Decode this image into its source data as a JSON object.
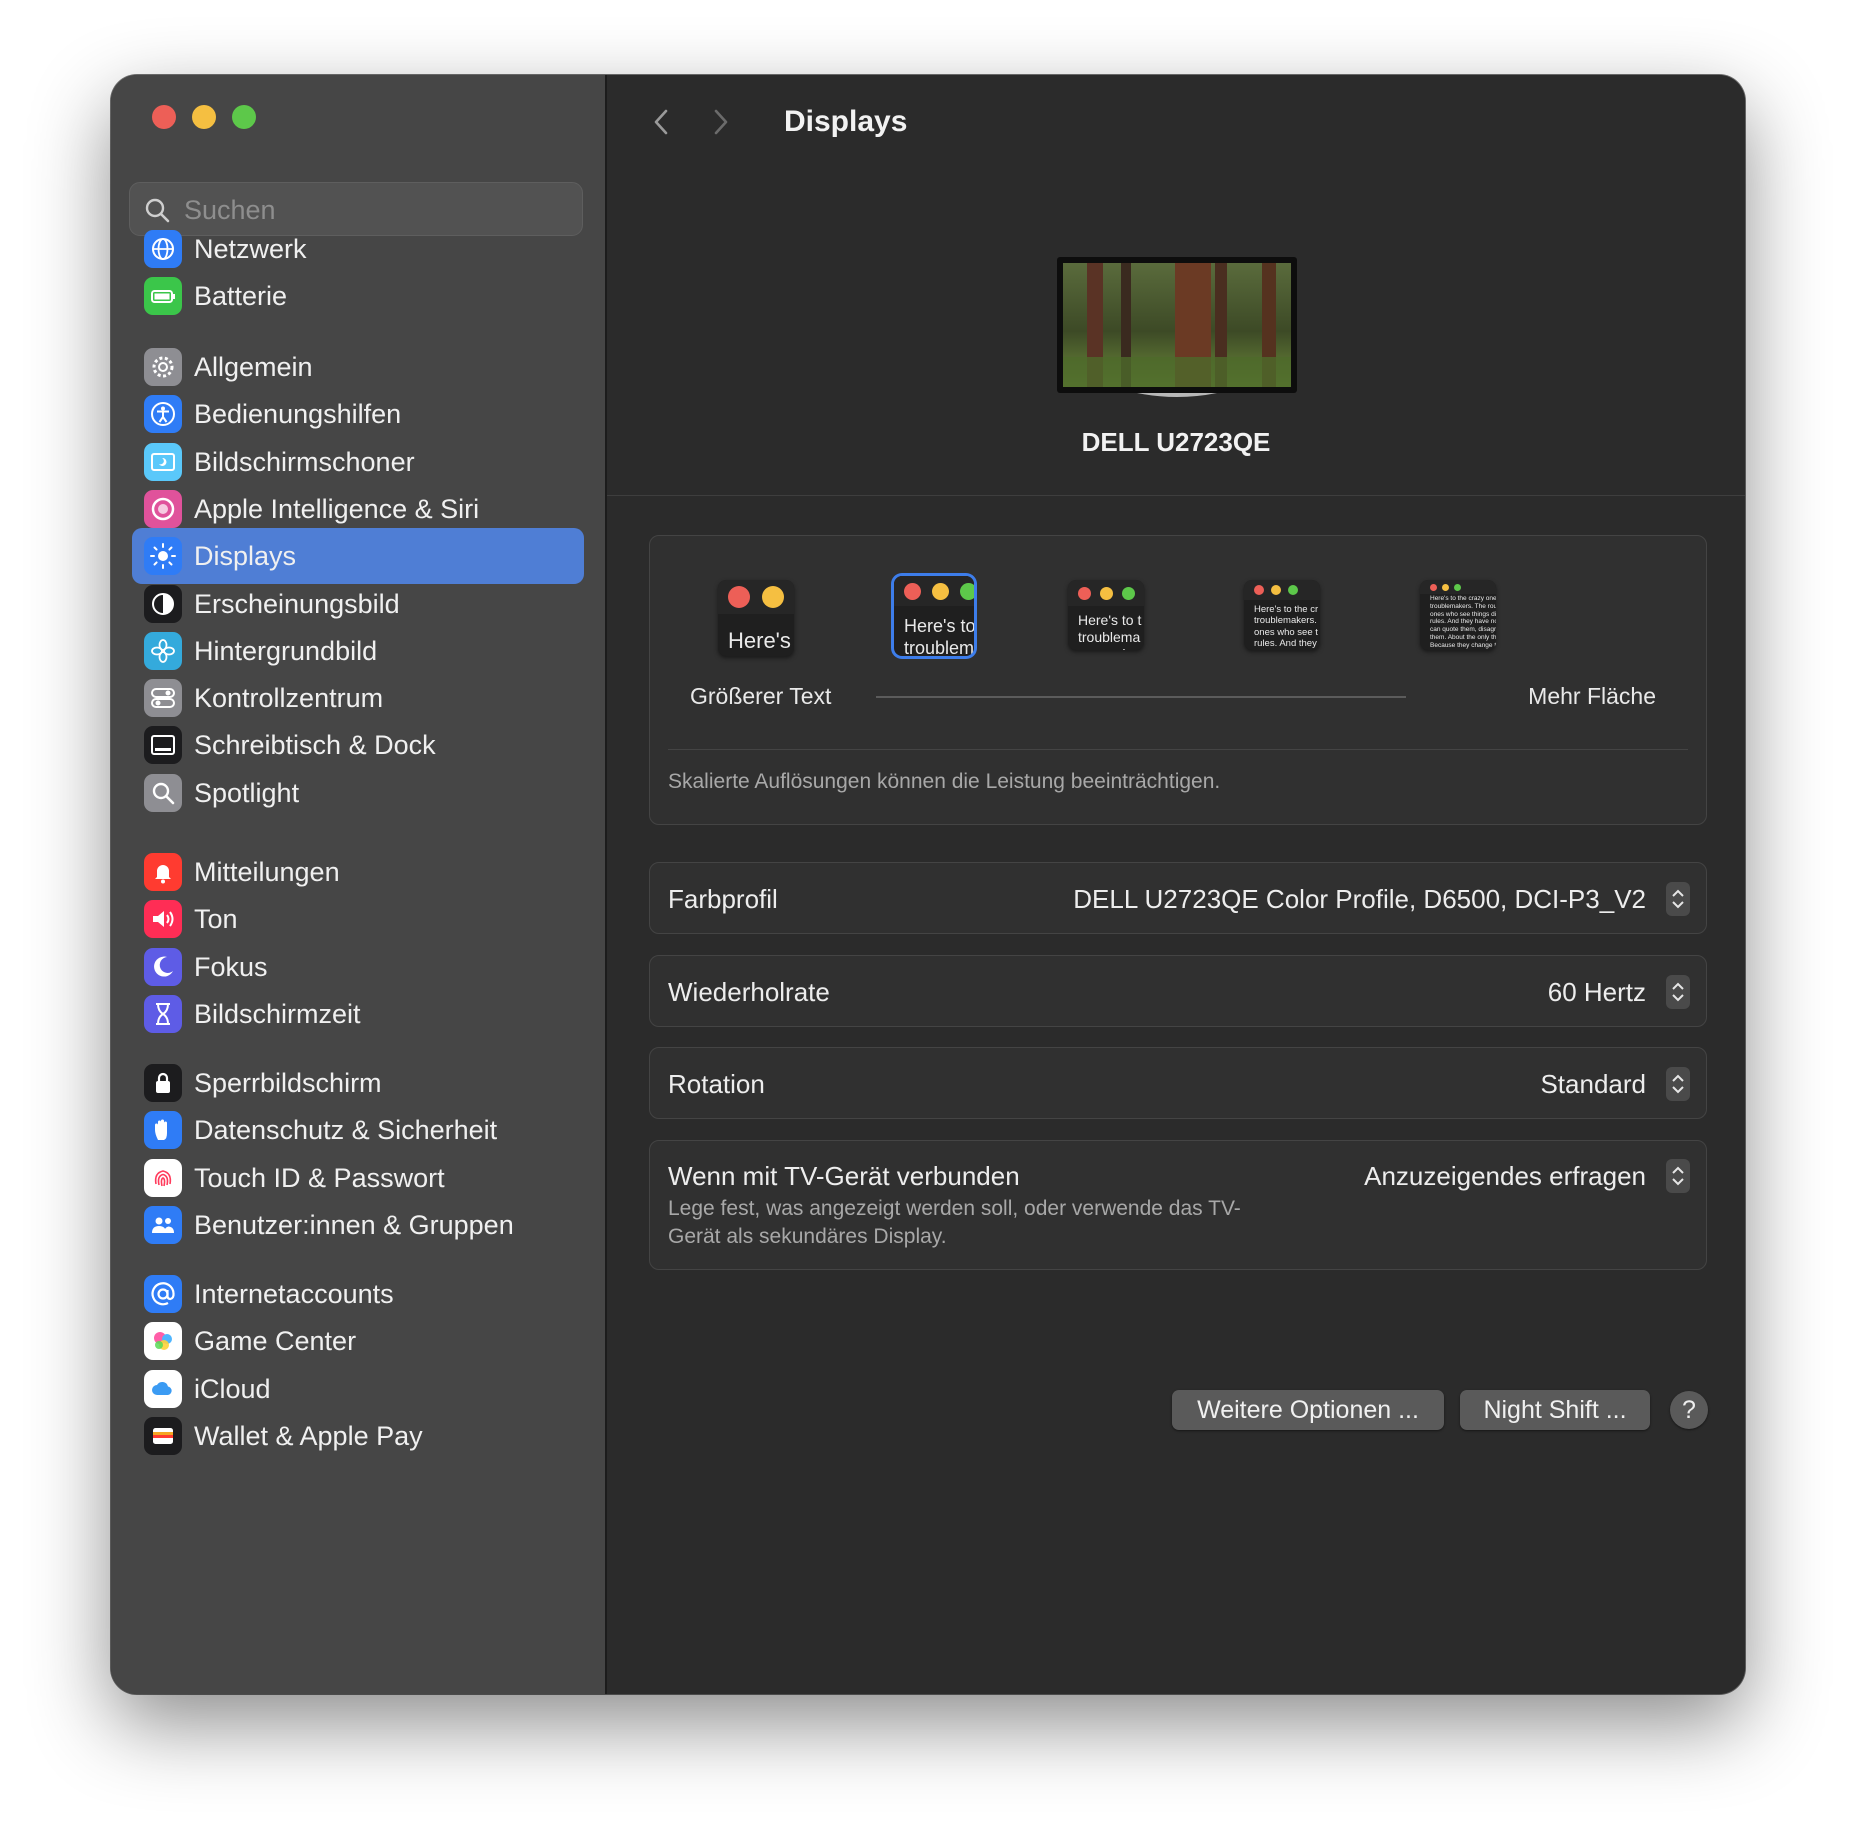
{
  "window": {
    "title": "Displays"
  },
  "sidebar": {
    "search_placeholder": "Suchen",
    "items": [
      {
        "label": "Netzwerk",
        "icon": "globe-icon",
        "color": "#2f7cf6"
      },
      {
        "label": "Batterie",
        "icon": "battery-icon",
        "color": "#3bc64a"
      },
      {
        "label": "Allgemein",
        "icon": "gear-icon",
        "color": "#8e8e93"
      },
      {
        "label": "Bedienungshilfen",
        "icon": "accessibility-icon",
        "color": "#2f7cf6"
      },
      {
        "label": "Bildschirmschoner",
        "icon": "screensaver-icon",
        "color": "#5ac8fa"
      },
      {
        "label": "Apple Intelligence & Siri",
        "icon": "siri-icon",
        "color": "#e0529b"
      },
      {
        "label": "Displays",
        "icon": "sun-icon",
        "color": "#2f7cf6",
        "selected": true
      },
      {
        "label": "Erscheinungsbild",
        "icon": "appearance-icon",
        "color": "#1c1c1e"
      },
      {
        "label": "Hintergrundbild",
        "icon": "flower-icon",
        "color": "#34aadc"
      },
      {
        "label": "Kontrollzentrum",
        "icon": "switches-icon",
        "color": "#8e8e93"
      },
      {
        "label": "Schreibtisch & Dock",
        "icon": "dock-icon",
        "color": "#1c1c1e"
      },
      {
        "label": "Spotlight",
        "icon": "magnifier-icon",
        "color": "#8e8e93"
      },
      {
        "label": "Mitteilungen",
        "icon": "bell-icon",
        "color": "#ff3b30"
      },
      {
        "label": "Ton",
        "icon": "speaker-icon",
        "color": "#ff2d55"
      },
      {
        "label": "Fokus",
        "icon": "moon-icon",
        "color": "#5e5ce6"
      },
      {
        "label": "Bildschirmzeit",
        "icon": "hourglass-icon",
        "color": "#5e5ce6"
      },
      {
        "label": "Sperrbildschirm",
        "icon": "lock-icon",
        "color": "#1c1c1e"
      },
      {
        "label": "Datenschutz & Sicherheit",
        "icon": "hand-icon",
        "color": "#2f7cf6"
      },
      {
        "label": "Touch ID & Passwort",
        "icon": "fingerprint-icon",
        "color": "#ffffff"
      },
      {
        "label": "Benutzer:innen & Gruppen",
        "icon": "users-icon",
        "color": "#2f7cf6"
      },
      {
        "label": "Internetaccounts",
        "icon": "at-icon",
        "color": "#2f7cf6"
      },
      {
        "label": "Game Center",
        "icon": "gamecenter-icon",
        "color": "#ffffff"
      },
      {
        "label": "iCloud",
        "icon": "cloud-icon",
        "color": "#ffffff"
      },
      {
        "label": "Wallet & Apple Pay",
        "icon": "wallet-icon",
        "color": "#1c1c1e"
      }
    ]
  },
  "main": {
    "title": "Displays",
    "display_name": "DELL U2723QE",
    "scaling": {
      "options": [
        {
          "preview_text": "Here's",
          "label": "Größerer Text"
        },
        {
          "preview_text": "Here's to troublem",
          "selected": true
        },
        {
          "preview_text": "Here's to t troublema ones who"
        },
        {
          "preview_text": "Here's to the cr troublemakers. ones who see t rules. And they"
        },
        {
          "preview_text": "Here's to the crazy ones troublemakers. The rou ones who see things dif rules. And they have no can quote them, disagr them. About the only th Because they change th",
          "label": "Mehr Fläche"
        }
      ],
      "note": "Skalierte Auflösungen können die Leistung beeinträchtigen."
    },
    "color_profile": {
      "label": "Farbprofil",
      "value": "DELL U2723QE Color Profile, D6500, DCI-P3_V2"
    },
    "refresh_rate": {
      "label": "Wiederholrate",
      "value": "60 Hertz"
    },
    "rotation": {
      "label": "Rotation",
      "value": "Standard"
    },
    "tv": {
      "label": "Wenn mit TV-Gerät verbunden",
      "value": "Anzuzeigendes erfragen",
      "description": "Lege fest, was angezeigt werden soll, oder verwende das TV-Gerät als sekundäres Display."
    },
    "buttons": {
      "more_options": "Weitere Optionen ...",
      "night_shift": "Night Shift ...",
      "help": "?"
    }
  }
}
